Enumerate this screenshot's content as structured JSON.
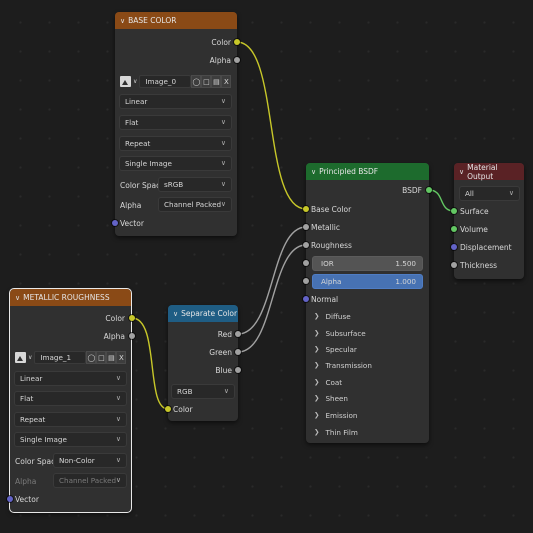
{
  "colors": {
    "color_header": "#8a4a16",
    "shader_header": "#1d6b2d",
    "converter_header": "#1f5d84",
    "output_header": "#5a2225",
    "yellow_wire": "#c7c729",
    "gray_wire": "#a1a1a1",
    "green_wire": "#63c763"
  },
  "base_color": {
    "title": "BASE COLOR",
    "out_color": "Color",
    "out_alpha": "Alpha",
    "image_name": "Image_0",
    "close": "X",
    "interpolation": "Linear",
    "projection": "Flat",
    "extension": "Repeat",
    "source": "Single Image",
    "color_space_label": "Color Space",
    "color_space": "sRGB",
    "alpha_label": "Alpha",
    "alpha_mode": "Channel Packed",
    "in_vector": "Vector"
  },
  "metallic_roughness": {
    "title": "METALLIC ROUGHNESS",
    "out_color": "Color",
    "out_alpha": "Alpha",
    "image_name": "Image_1",
    "close": "X",
    "interpolation": "Linear",
    "projection": "Flat",
    "extension": "Repeat",
    "source": "Single Image",
    "color_space_label": "Color Space",
    "color_space": "Non-Color",
    "alpha_label": "Alpha",
    "alpha_mode": "Channel Packed",
    "in_vector": "Vector"
  },
  "separate_color": {
    "title": "Separate Color",
    "out_red": "Red",
    "out_green": "Green",
    "out_blue": "Blue",
    "mode": "RGB",
    "in_color": "Color"
  },
  "principled": {
    "title": "Principled BSDF",
    "out_bsdf": "BSDF",
    "base_color": "Base Color",
    "metallic": "Metallic",
    "roughness": "Roughness",
    "ior_label": "IOR",
    "ior_value": "1.500",
    "alpha_label": "Alpha",
    "alpha_value": "1.000",
    "normal": "Normal",
    "panels": [
      "Diffuse",
      "Subsurface",
      "Specular",
      "Transmission",
      "Coat",
      "Sheen",
      "Emission",
      "Thin Film"
    ]
  },
  "material_output": {
    "title": "Material Output",
    "target": "All",
    "surface": "Surface",
    "volume": "Volume",
    "displacement": "Displacement",
    "thickness": "Thickness"
  }
}
